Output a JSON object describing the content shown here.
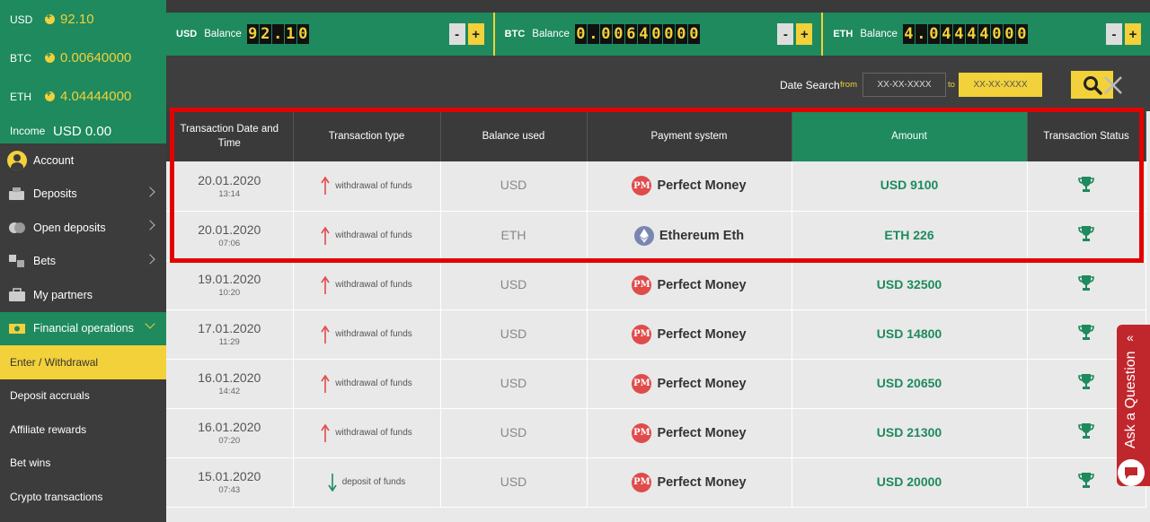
{
  "sidebar": {
    "balances": [
      {
        "currency": "USD",
        "value": "92.10"
      },
      {
        "currency": "BTC",
        "value": "0.00640000"
      },
      {
        "currency": "ETH",
        "value": "4.04444000"
      }
    ],
    "income_label": "Income",
    "income_value": "USD 0.00",
    "nav": [
      {
        "label": "Account",
        "icon": "user-avatar-icon"
      },
      {
        "label": "Deposits",
        "icon": "deposits-icon"
      },
      {
        "label": "Open deposits",
        "icon": "open-deposits-icon"
      },
      {
        "label": "Bets",
        "icon": "bets-icon"
      },
      {
        "label": "My partners",
        "icon": "partners-icon"
      },
      {
        "label": "Financial operations",
        "icon": "financial-operations-icon"
      }
    ],
    "subnav": [
      {
        "label": "Enter / Withdrawal"
      },
      {
        "label": "Deposit accruals"
      },
      {
        "label": "Affiliate rewards"
      },
      {
        "label": "Bet wins"
      },
      {
        "label": "Crypto transactions"
      }
    ]
  },
  "topbar": {
    "balance_label": "Balance",
    "segments": [
      {
        "currency": "USD",
        "digits": [
          "9",
          "2",
          ".",
          "1",
          "0"
        ]
      },
      {
        "currency": "BTC",
        "digits": [
          "0",
          ".",
          "0",
          "0",
          "6",
          "4",
          "0",
          "0",
          "0",
          "0"
        ]
      },
      {
        "currency": "ETH",
        "digits": [
          "4",
          ".",
          "0",
          "4",
          "4",
          "4",
          "4",
          "0",
          "0",
          "0"
        ]
      }
    ],
    "minus": "-",
    "plus": "+"
  },
  "search": {
    "label": "Date Search",
    "from": "from",
    "to": "to",
    "from_placeholder": "XX-XX-XXXX",
    "to_placeholder": "XX-XX-XXXX"
  },
  "table": {
    "headers": [
      "Transaction Date and Time",
      "Transaction type",
      "Balance used",
      "Payment system",
      "Amount",
      "Transaction Status"
    ],
    "rows": [
      {
        "date": "20.01.2020",
        "time": "13:14",
        "type": "withdrawal of funds",
        "direction": "up",
        "balance": "USD",
        "payment": "Perfect Money",
        "logo": "PM",
        "amount": "USD 9100"
      },
      {
        "date": "20.01.2020",
        "time": "07:06",
        "type": "withdrawal of funds",
        "direction": "up",
        "balance": "ETH",
        "payment": "Ethereum Eth",
        "logo": "ETH",
        "amount": "ETH 226"
      },
      {
        "date": "19.01.2020",
        "time": "10:20",
        "type": "withdrawal of funds",
        "direction": "up",
        "balance": "USD",
        "payment": "Perfect Money",
        "logo": "PM",
        "amount": "USD 32500"
      },
      {
        "date": "17.01.2020",
        "time": "11:29",
        "type": "withdrawal of funds",
        "direction": "up",
        "balance": "USD",
        "payment": "Perfect Money",
        "logo": "PM",
        "amount": "USD 14800"
      },
      {
        "date": "16.01.2020",
        "time": "14:42",
        "type": "withdrawal of funds",
        "direction": "up",
        "balance": "USD",
        "payment": "Perfect Money",
        "logo": "PM",
        "amount": "USD 20650"
      },
      {
        "date": "16.01.2020",
        "time": "07:20",
        "type": "withdrawal of funds",
        "direction": "up",
        "balance": "USD",
        "payment": "Perfect Money",
        "logo": "PM",
        "amount": "USD 21300"
      },
      {
        "date": "15.01.2020",
        "time": "07:43",
        "type": "deposit of funds",
        "direction": "down",
        "balance": "USD",
        "payment": "Perfect Money",
        "logo": "PM",
        "amount": "USD 20000"
      }
    ]
  },
  "ask": {
    "label": "Ask a Question"
  },
  "colors": {
    "green": "#1e8a5e",
    "yellow": "#f2d13a",
    "highlight": "#e30000",
    "dark": "#3c3c3c"
  }
}
